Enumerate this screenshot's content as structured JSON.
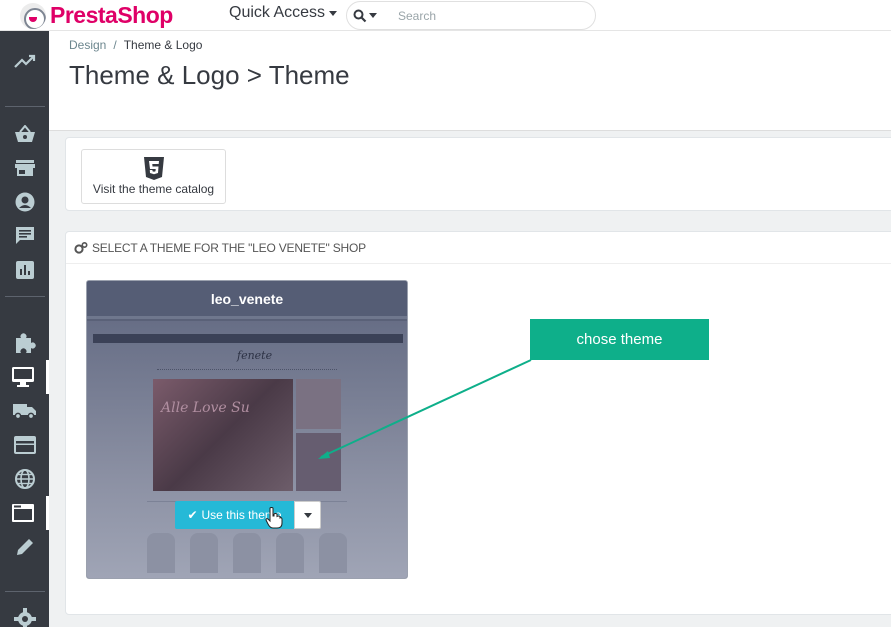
{
  "header": {
    "logo_text": "PrestaShop",
    "quick_access_label": "Quick Access",
    "search_placeholder": "Search"
  },
  "sidebar": {
    "items": [
      {
        "icon": "trending-up-icon"
      },
      {
        "icon": "basket-icon"
      },
      {
        "icon": "store-icon"
      },
      {
        "icon": "account-icon"
      },
      {
        "icon": "chat-icon"
      },
      {
        "icon": "bar-chart-icon"
      },
      {
        "icon": "puzzle-icon"
      },
      {
        "icon": "desktop-icon",
        "active": true
      },
      {
        "icon": "truck-icon"
      },
      {
        "icon": "credit-card-icon"
      },
      {
        "icon": "globe-icon"
      },
      {
        "icon": "window-icon",
        "active": true
      },
      {
        "icon": "pencil-icon"
      },
      {
        "icon": "settings-icon"
      }
    ]
  },
  "breadcrumb": {
    "parent": "Design",
    "separator": "/",
    "current": "Theme & Logo"
  },
  "page": {
    "title": "Theme & Logo > Theme"
  },
  "catalog": {
    "button_label": "Visit the theme catalog"
  },
  "themes_panel": {
    "heading": "SELECT A THEME FOR THE \"LEO VENETE\" SHOP",
    "theme": {
      "name": "leo_venete",
      "preview_logo": "fenete",
      "preview_hero_text": "Alle Love Su",
      "use_button_label": "Use this theme"
    }
  },
  "annotation": {
    "callout_text": "chose theme",
    "color": "#0eaf8a"
  },
  "colors": {
    "brand": "#df0067",
    "sidebar": "#363a41",
    "primary_button": "#25b9d7"
  }
}
